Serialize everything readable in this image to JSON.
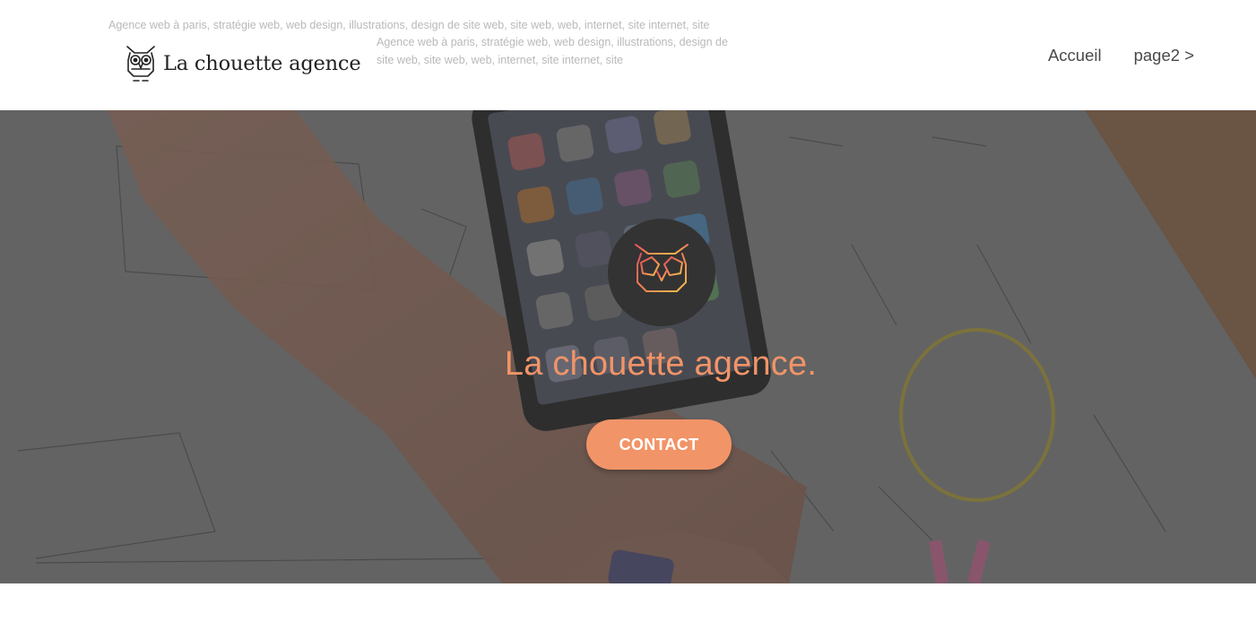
{
  "header": {
    "seo_line_1": "Agence web à paris, stratégie web, web design, illustrations, design de site web, site web, web, internet, site internet, site",
    "seo_line_2": "Agence web à paris, stratégie web, web design, illustrations, design de site web, site web, web, internet, site internet, site",
    "brand_name": "La chouette agence",
    "brand_logo_icon": "owl-icon",
    "nav": [
      {
        "label": "Accueil"
      },
      {
        "label": "page2 >"
      }
    ]
  },
  "hero": {
    "background_image": "desk-sketch-phone-photo",
    "badge_icon": "owl-icon",
    "title": "La chouette agence.",
    "cta_label": "CONTACT"
  },
  "colors": {
    "accent": "#f19468",
    "badge_bg": "#333333",
    "header_bg": "#ffffff",
    "seo_text": "#b9b9b9"
  }
}
